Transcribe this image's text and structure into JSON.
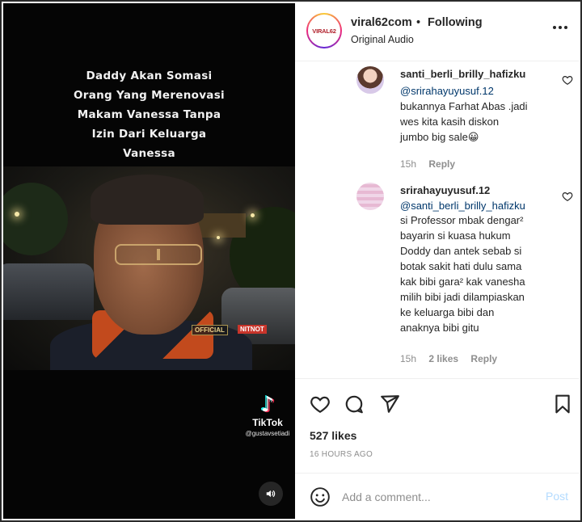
{
  "video": {
    "caption_lines": [
      "Daddy Akan Somasi",
      "Orang Yang Merenovasi",
      "Makam Vanessa Tanpa",
      "Izin Dari Keluarga",
      "Vanessa"
    ],
    "tag_official": "OFFICIAL",
    "tag_channel": "NITNOT",
    "watermark": {
      "brand": "TikTok",
      "handle": "@gustavsetiadi"
    },
    "sound_icon": "speaker-icon"
  },
  "header": {
    "avatar_text": "VIRAL62",
    "username": "viral62com",
    "separator": "•",
    "follow_status": "Following",
    "audio": "Original Audio",
    "more_icon": "more-horizontal-icon"
  },
  "comments": [
    {
      "username": "santi_berli_brilly_hafizku",
      "mention": "@srirahayuyusuf.12",
      "text": "bukannya Farhat Abas .jadi wes kita kasih diskon jumbo big sale😀",
      "lines": [
        "bukannya Farhat Abas .jadi",
        "wes kita kasih diskon",
        "jumbo big sale😀"
      ],
      "time": "15h",
      "likes": "",
      "reply": "Reply"
    },
    {
      "username": "srirahayuyusuf.12",
      "mention": "@santi_berli_brilly_hafizku",
      "lines": [
        "si Professor mbak dengar²",
        "bayarin si kuasa hukum",
        "Doddy dan antek sebab si",
        "botak sakit hati dulu sama",
        "kak bibi gara² kak vanesha",
        "milih bibi jadi dilampiaskan",
        "ke keluarga bibi dan",
        "anaknya bibi gitu"
      ],
      "time": "15h",
      "likes": "2 likes",
      "reply": "Reply"
    }
  ],
  "actions": {
    "like_icon": "heart-icon",
    "comment_icon": "comment-icon",
    "share_icon": "share-icon",
    "save_icon": "bookmark-icon",
    "likes": "527 likes",
    "time": "16 HOURS AGO"
  },
  "add_comment": {
    "emoji_icon": "emoji-icon",
    "placeholder": "Add a comment...",
    "post_label": "Post"
  },
  "colors": {
    "link": "#00376b",
    "muted": "#8e8e8e",
    "post_disabled": "#b3dbff"
  }
}
